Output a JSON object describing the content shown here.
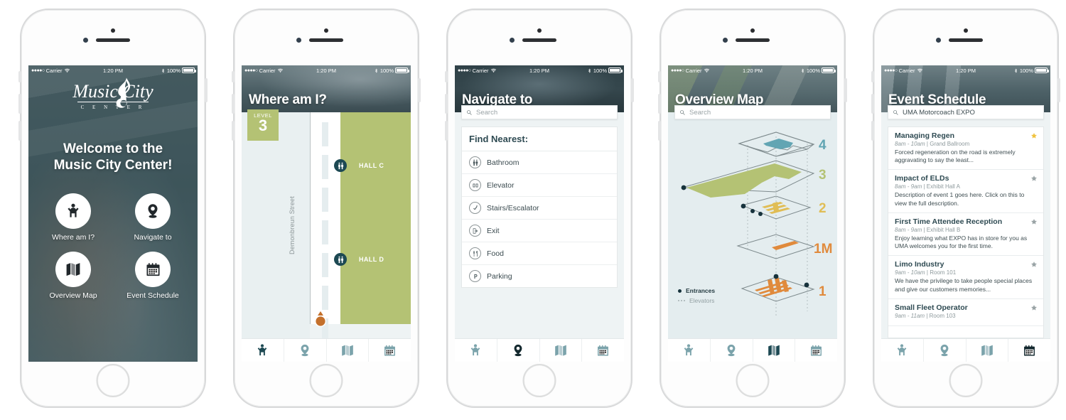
{
  "status_bar": {
    "signal_dots": "●●●●○",
    "carrier": "Carrier",
    "wifi_icon": "wifi-icon",
    "time": "1:20 PM",
    "bluetooth_icon": "bluetooth-icon",
    "battery_percent": "100%"
  },
  "colors": {
    "olive": "#b4c274",
    "teal_dark": "#1d4953",
    "teal_icon": "#7ba3ab",
    "orange": "#c4702c",
    "gold_star": "#f0c340",
    "screen_bg": "#eef3f4",
    "header_text": "#ffffff",
    "map_bg": "#e4edef"
  },
  "tab_bar": {
    "tabs": [
      {
        "name": "tab-where-am-i",
        "icon": "person-raised-arms-icon",
        "label": "Where am I?"
      },
      {
        "name": "tab-navigate-to",
        "icon": "location-pin-icon",
        "label": "Navigate to"
      },
      {
        "name": "tab-overview-map",
        "icon": "map-icon",
        "label": "Overview Map"
      },
      {
        "name": "tab-event-schedule",
        "icon": "calendar-icon",
        "label": "Event Schedule"
      }
    ]
  },
  "screen_home": {
    "logo": {
      "line1": "Music City",
      "line2": "C E N T E R",
      "note_icon": "music-note-icon"
    },
    "welcome_line1": "Welcome to the",
    "welcome_line2": "Music City Center!",
    "tiles": [
      {
        "icon": "person-raised-arms-icon",
        "label": "Where am I?"
      },
      {
        "icon": "location-pin-icon",
        "label": "Navigate to"
      },
      {
        "icon": "map-icon",
        "label": "Overview Map"
      },
      {
        "icon": "calendar-icon",
        "label": "Event Schedule"
      }
    ],
    "active_tab_index": 0
  },
  "screen_where": {
    "title": "Where am I?",
    "level_word": "LEVEL",
    "level_number": "3",
    "street_label": "Demonbreun Street",
    "halls": [
      {
        "label": "HALL C"
      },
      {
        "label": "HALL D"
      }
    ],
    "map_icons": [
      {
        "icon": "restroom-icon"
      },
      {
        "icon": "restroom-icon"
      }
    ],
    "you_are_here_icon": "you-are-here-marker",
    "active_tab_index": 0
  },
  "screen_navigate": {
    "title": "Navigate to",
    "search": {
      "placeholder": "Search",
      "value": "",
      "icon": "search-icon"
    },
    "card_heading": "Find Nearest:",
    "items": [
      {
        "icon": "restroom-icon",
        "label": "Bathroom"
      },
      {
        "icon": "elevator-icon",
        "label": "Elevator"
      },
      {
        "icon": "stairs-escalator-icon",
        "label": "Stairs/Escalator"
      },
      {
        "icon": "exit-icon",
        "label": "Exit"
      },
      {
        "icon": "food-icon",
        "label": "Food"
      },
      {
        "icon": "parking-icon",
        "label": "Parking"
      }
    ],
    "active_tab_index": 1
  },
  "screen_overview": {
    "title": "Overview Map",
    "search": {
      "placeholder": "Search",
      "value": "",
      "icon": "search-icon"
    },
    "floors": [
      {
        "label": "4",
        "color": "#6aa8b5"
      },
      {
        "label": "3",
        "color": "#b4c274"
      },
      {
        "label": "2",
        "color": "#e0bd55"
      },
      {
        "label": "1M",
        "color": "#e08a3c"
      },
      {
        "label": "1",
        "color": "#e08a3c"
      }
    ],
    "legend": [
      {
        "marker": "dot",
        "label": "Entrances"
      },
      {
        "marker": "dotted-line",
        "label": "Elevators"
      }
    ],
    "active_tab_index": 2
  },
  "screen_events": {
    "title": "Event Schedule",
    "search": {
      "placeholder": "Search",
      "value": "UMA Motorcoach EXPO",
      "icon": "search-icon"
    },
    "events": [
      {
        "title": "Managing Regen",
        "time": "8am - 10am",
        "location": "Grand Ballroom",
        "description": "Forced regeneration on the road is extremely aggravating to say the least...",
        "favorited": true
      },
      {
        "title": "Impact of ELDs",
        "time": "8am - 9am",
        "location": "Exhibit Hall A",
        "description": "Description of event 1 goes here. Click on this to  view the full description.",
        "favorited": false
      },
      {
        "title": "First Time Attendee Reception",
        "time": "8am - 9am",
        "location": "Exhibit Hall B",
        "description": "Enjoy learning what EXPO has in store for you as UMA welcomes you for the first time.",
        "favorited": false
      },
      {
        "title": "Limo Industry",
        "time": "9am - 10am",
        "location": "Room 101",
        "description": "We have the privilege to take people special places and give our customers memories...",
        "favorited": false
      },
      {
        "title": "Small Fleet Operator",
        "time": "9am - 11am",
        "location": "Room 103",
        "description": "",
        "favorited": false
      }
    ],
    "active_tab_index": 3
  }
}
